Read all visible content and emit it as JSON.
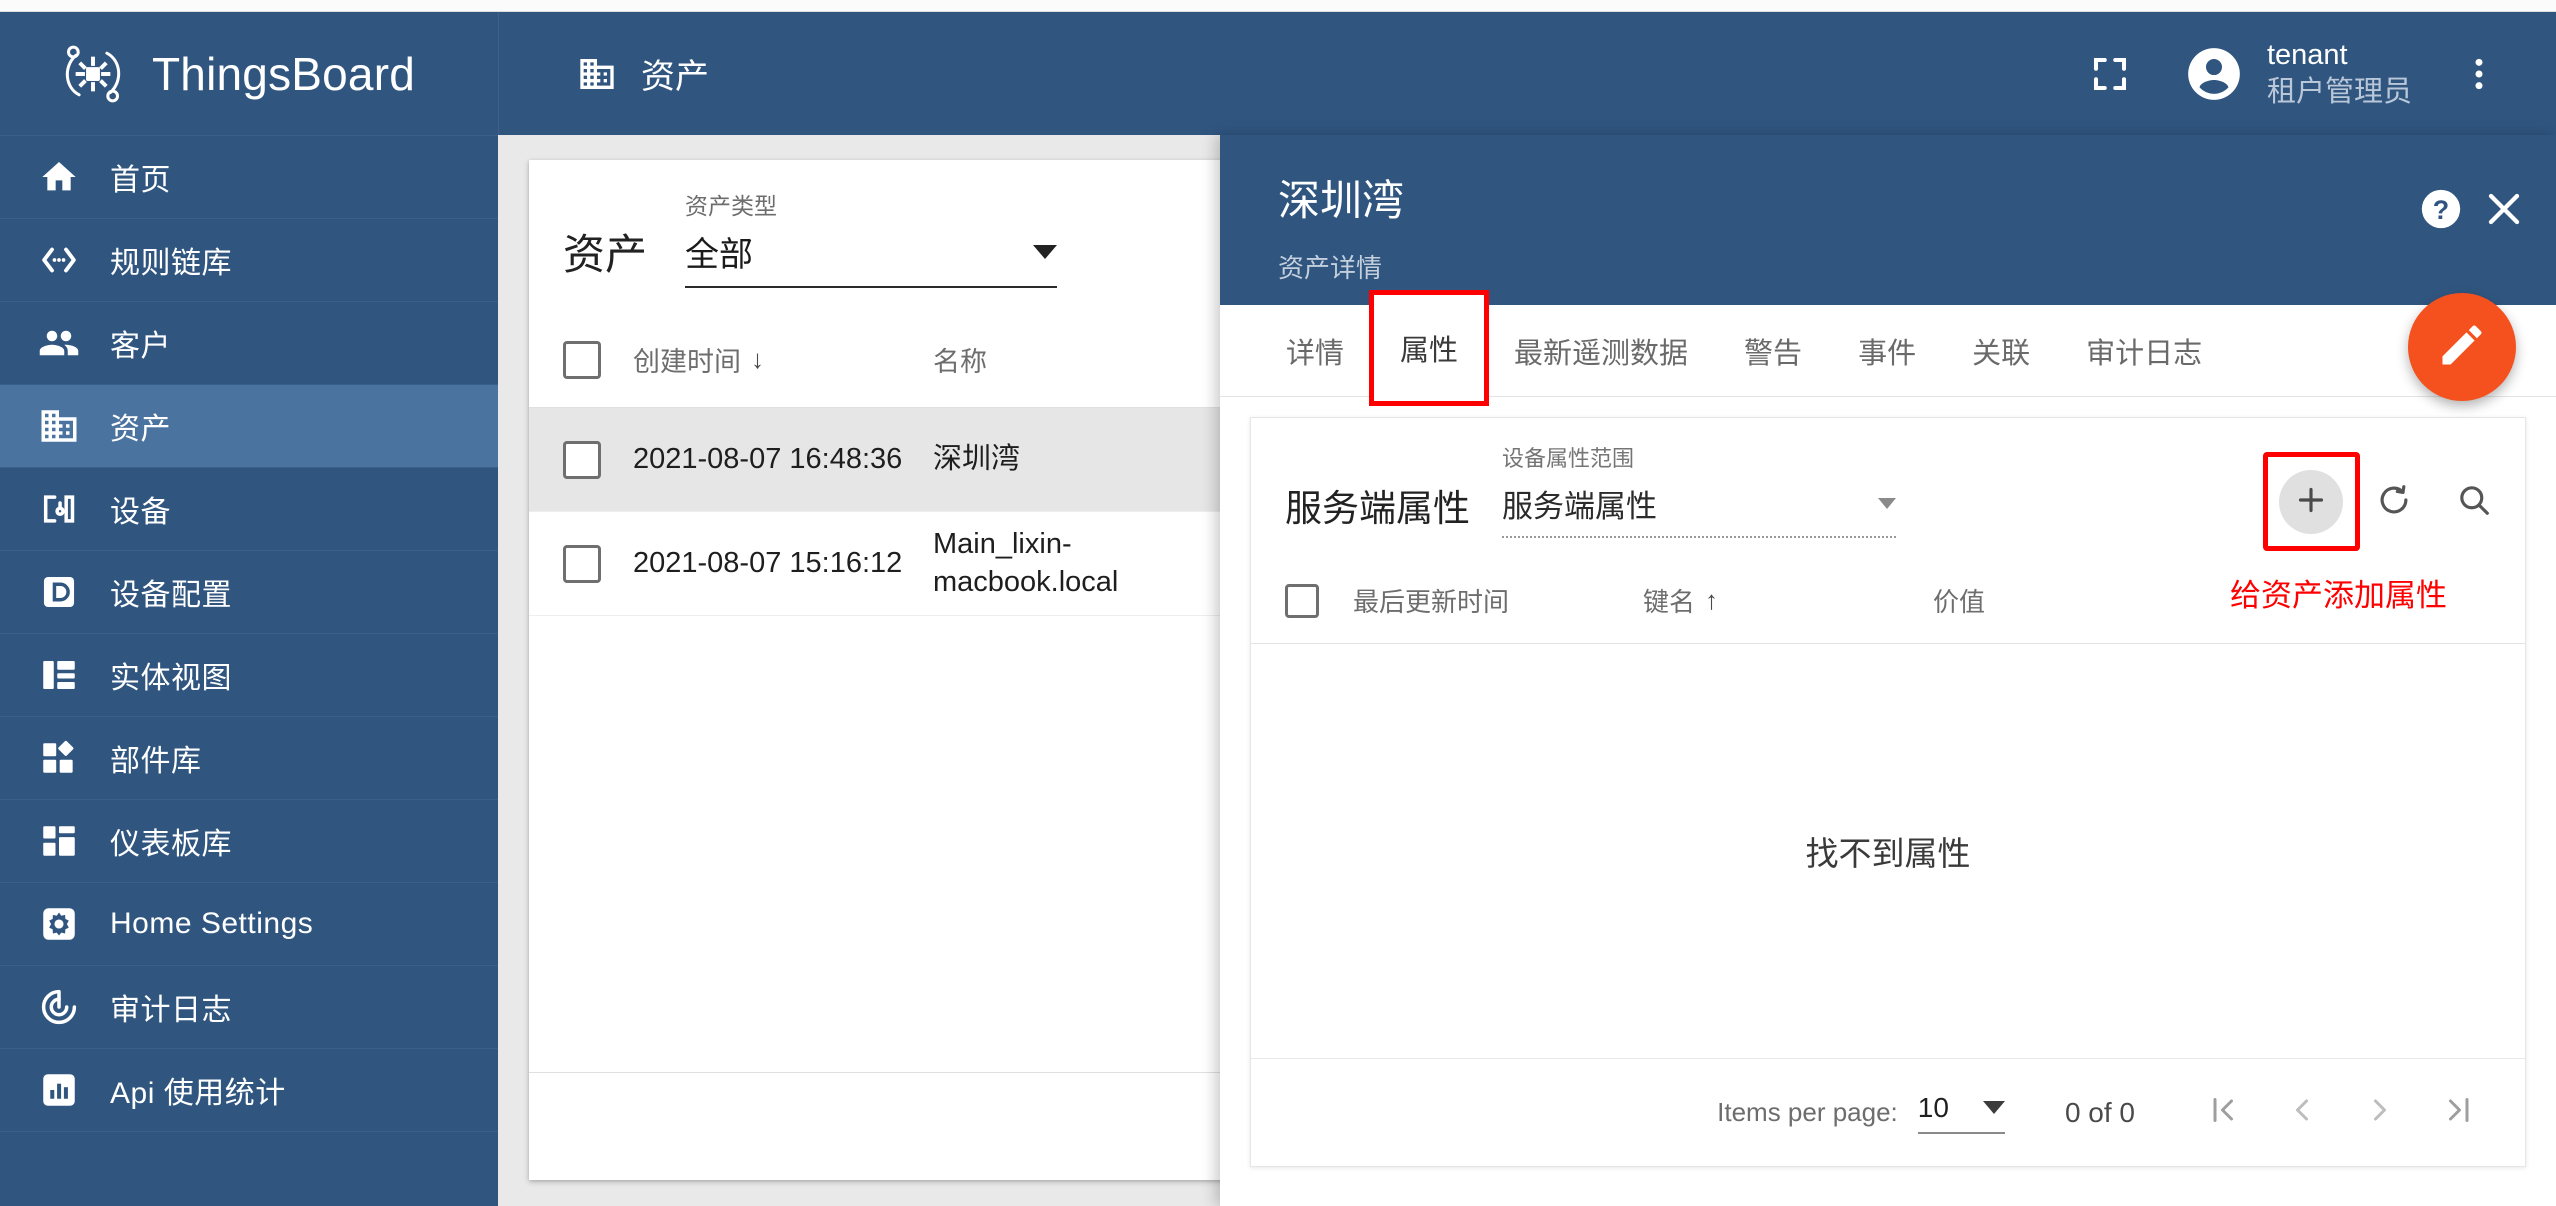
{
  "brand": {
    "name": "ThingsBoard",
    "logo_icon": "thingsboard-logo-icon"
  },
  "sidebar": {
    "items": [
      {
        "label": "首页",
        "icon": "home-icon",
        "key": "home",
        "active": false
      },
      {
        "label": "规则链库",
        "icon": "rule-chain-icon",
        "key": "rule-chains",
        "active": false
      },
      {
        "label": "客户",
        "icon": "customers-icon",
        "key": "customers",
        "active": false
      },
      {
        "label": "资产",
        "icon": "assets-icon",
        "key": "assets",
        "active": true
      },
      {
        "label": "设备",
        "icon": "devices-icon",
        "key": "devices",
        "active": false
      },
      {
        "label": "设备配置",
        "icon": "device-profiles-icon",
        "key": "device-profiles",
        "active": false
      },
      {
        "label": "实体视图",
        "icon": "entity-views-icon",
        "key": "entity-views",
        "active": false
      },
      {
        "label": "部件库",
        "icon": "widget-library-icon",
        "key": "widget-library",
        "active": false
      },
      {
        "label": "仪表板库",
        "icon": "dashboards-icon",
        "key": "dashboards",
        "active": false
      },
      {
        "label": "Home Settings",
        "icon": "settings-gear-icon",
        "key": "home-settings",
        "active": false
      },
      {
        "label": "审计日志",
        "icon": "audit-log-icon",
        "key": "audit-log",
        "active": false
      },
      {
        "label": "Api 使用统计",
        "icon": "api-usage-icon",
        "key": "api-usage",
        "active": false
      }
    ]
  },
  "topbar": {
    "page_icon": "assets-icon",
    "page_title": "资产",
    "fullscreen_icon": "fullscreen-icon",
    "account_icon": "account-circle-icon",
    "user_name": "tenant",
    "user_role": "租户管理员",
    "more_icon": "more-vert-icon"
  },
  "asset_list": {
    "title": "资产",
    "filter": {
      "label": "资产类型",
      "value": "全部",
      "caret_icon": "chevron-down-icon"
    },
    "columns": [
      "创建时间",
      "名称"
    ],
    "sort_icon": "arrow-down-icon",
    "rows": [
      {
        "created": "2021-08-07 16:48:36",
        "name": "深圳湾",
        "selected": true
      },
      {
        "created": "2021-08-07 15:16:12",
        "name": "Main_lixin-macbook.local",
        "selected": false
      }
    ]
  },
  "detail": {
    "title": "深圳湾",
    "subtitle": "资产详情",
    "help_icon": "help-circle-icon",
    "close_icon": "close-icon",
    "edit_fab_icon": "pencil-icon",
    "tabs": [
      {
        "label": "详情",
        "active": false,
        "annotated": false
      },
      {
        "label": "属性",
        "active": true,
        "annotated": true
      },
      {
        "label": "最新遥测数据",
        "active": false,
        "annotated": false
      },
      {
        "label": "警告",
        "active": false,
        "annotated": false
      },
      {
        "label": "事件",
        "active": false,
        "annotated": false
      },
      {
        "label": "关联",
        "active": false,
        "annotated": false
      },
      {
        "label": "审计日志",
        "active": false,
        "annotated": false
      }
    ],
    "attributes": {
      "title": "服务端属性",
      "scope": {
        "label": "设备属性范围",
        "value": "服务端属性",
        "caret_icon": "chevron-down-icon"
      },
      "add_icon": "plus-icon",
      "refresh_icon": "refresh-icon",
      "search_icon": "search-icon",
      "annotation": "给资产添加属性",
      "annotation_color": "#FF0000",
      "columns": [
        "最后更新时间",
        "键名",
        "价值"
      ],
      "key_sort_icon": "arrow-up-icon",
      "empty_text": "找不到属性",
      "rows": []
    },
    "paginator": {
      "items_per_page_label": "Items per page:",
      "items_per_page_value": "10",
      "caret_icon": "chevron-down-icon",
      "range_label": "0 of 0",
      "first_icon": "first-page-icon",
      "prev_icon": "prev-page-icon",
      "next_icon": "next-page-icon",
      "last_icon": "last-page-icon"
    }
  },
  "colors": {
    "primary": "#305680",
    "accent": "#F4511E",
    "annotation": "#FF0000",
    "sidebar_active": "#4A73A0"
  }
}
